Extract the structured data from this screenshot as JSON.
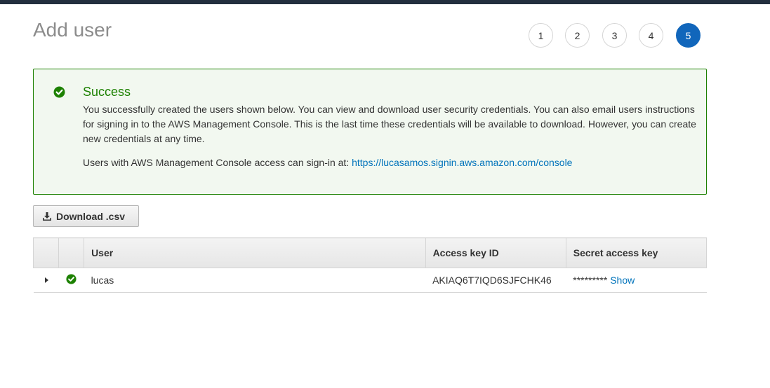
{
  "page_title": "Add user",
  "steps": [
    "1",
    "2",
    "3",
    "4",
    "5"
  ],
  "active_step": "5",
  "alert": {
    "title": "Success",
    "text": "You successfully created the users shown below. You can view and download user security credentials. You can also email users instructions for signing in to the AWS Management Console. This is the last time these credentials will be available to download. However, you can create new credentials at any time.",
    "signin_prefix": "Users with AWS Management Console access can sign-in at:",
    "signin_url": "https://lucasamos.signin.aws.amazon.com/console"
  },
  "download_button": "Download .csv",
  "table": {
    "headers": [
      "User",
      "Access key ID",
      "Secret access key"
    ],
    "rows": [
      {
        "user": "lucas",
        "access_key_id": "AKIAQ6T7IQD6SJFCHK46",
        "secret_masked": "*********",
        "show_label": "Show"
      }
    ]
  },
  "colors": {
    "accent": "#1166bb",
    "success": "#1d8102",
    "link": "#0073bb",
    "topbar": "#232f3e"
  }
}
